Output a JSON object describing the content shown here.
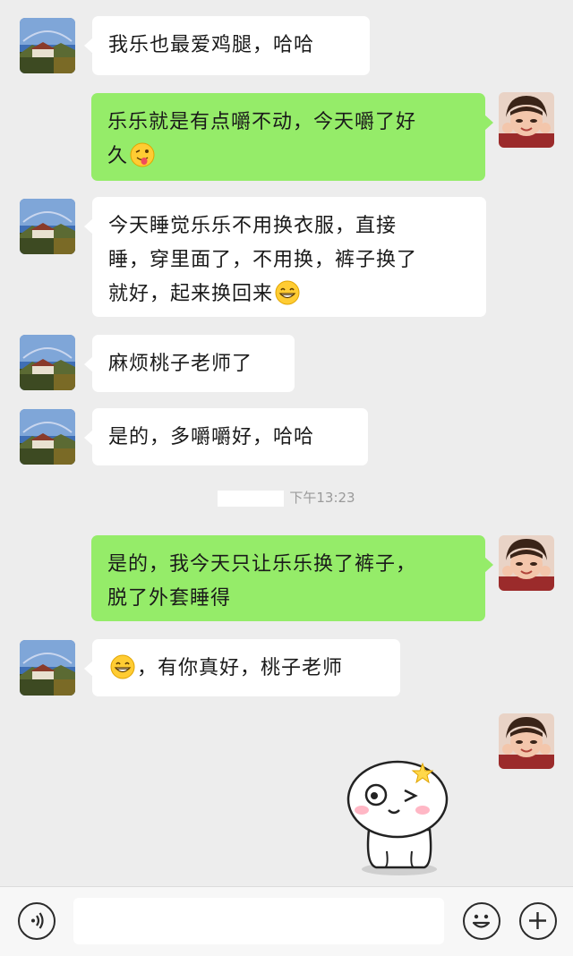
{
  "messages": [
    {
      "side": "in",
      "text": "我乐也最爱鸡腿，哈哈",
      "avatar": "landscape-avatar"
    },
    {
      "side": "out",
      "text_parts": [
        "乐乐就是有点嚼不动，今天嚼了好",
        "久"
      ],
      "emoji": "tongue-wink-emoji",
      "avatar": "child-avatar"
    },
    {
      "side": "in",
      "text_lines": [
        "今天睡觉乐乐不用换衣服，直接",
        "睡，穿里面了，不用换，裤子换了",
        "就好，起来换回来"
      ],
      "emoji": "grin-emoji",
      "avatar": "landscape-avatar"
    },
    {
      "side": "in",
      "text": "麻烦桃子老师了",
      "avatar": "landscape-avatar"
    },
    {
      "side": "in",
      "text": "是的，多嚼嚼好，哈哈",
      "avatar": "landscape-avatar"
    },
    {
      "side": "out",
      "text_lines": [
        "是的，我今天只让乐乐换了裤子，",
        "脱了外套睡得"
      ],
      "avatar": "child-avatar"
    },
    {
      "side": "in",
      "text": "，有你真好，桃子老师",
      "emoji": "grin-emoji",
      "avatar": "landscape-avatar"
    },
    {
      "side": "out",
      "sticker": "winking-bun-sticker",
      "avatar": "child-avatar"
    }
  ],
  "timestamp": "下午13:23",
  "input_bar": {
    "voice_icon": "voice-icon",
    "emoji_icon": "emoji-icon",
    "plus_icon": "plus-icon",
    "placeholder": ""
  },
  "colors": {
    "background": "#ededed",
    "outgoing_bubble": "#95ec69",
    "incoming_bubble": "#ffffff"
  }
}
